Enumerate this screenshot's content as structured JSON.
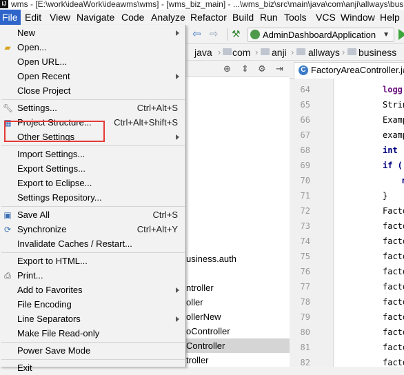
{
  "window": {
    "title": "wms - [E:\\work\\ideaWork\\ideawms\\wms] - [wms_biz_main] - ...\\wms_biz\\src\\main\\java\\com\\anji\\allways\\business\\controller\\FactoryAreaController.java"
  },
  "menubar": {
    "items": [
      "File",
      "Edit",
      "View",
      "Navigate",
      "Code",
      "Analyze",
      "Refactor",
      "Build",
      "Run",
      "Tools",
      "VCS",
      "Window",
      "Help"
    ]
  },
  "file_menu": {
    "new": "New",
    "open": "Open...",
    "open_url": "Open URL...",
    "open_recent": "Open Recent",
    "close_project": "Close Project",
    "settings": "Settings...",
    "settings_shortcut": "Ctrl+Alt+S",
    "project_structure": "Project Structure...",
    "project_structure_shortcut": "Ctrl+Alt+Shift+S",
    "other_settings": "Other Settings",
    "import_settings": "Import Settings...",
    "export_settings": "Export Settings...",
    "export_eclipse": "Export to Eclipse...",
    "settings_repository": "Settings Repository...",
    "save_all": "Save All",
    "save_all_shortcut": "Ctrl+S",
    "synchronize": "Synchronize",
    "synchronize_shortcut": "Ctrl+Alt+Y",
    "invalidate_caches": "Invalidate Caches / Restart...",
    "export_html": "Export to HTML...",
    "print": "Print...",
    "add_favorites": "Add to Favorites",
    "file_encoding": "File Encoding",
    "line_separators": "Line Separators",
    "make_read_only": "Make File Read-only",
    "power_save": "Power Save Mode",
    "exit": "Exit"
  },
  "toolbar": {
    "run_config": "AdminDashboardApplication"
  },
  "breadcrumb": [
    "java",
    "com",
    "anji",
    "allways",
    "business"
  ],
  "project_tree": {
    "rows": [
      "usiness.auth",
      "ntroller",
      "oller",
      "ollerNew",
      "oController",
      "Controller",
      "troller"
    ]
  },
  "editor": {
    "tab_label": "FactoryAreaController.java",
    "line_numbers": [
      "64",
      "65",
      "66",
      "67",
      "68",
      "69",
      "70",
      "71",
      "72",
      "73",
      "74",
      "75",
      "76",
      "77",
      "78",
      "79",
      "80",
      "81",
      "82"
    ],
    "code_lines": [
      "logg",
      "Strin",
      "Examp",
      "examp",
      "int ",
      "if (",
      "r",
      "}",
      "Facto",
      "facto",
      "facto",
      "facto",
      "facto",
      "facto",
      "facto",
      "facto",
      "facto",
      "facto",
      "facto"
    ]
  },
  "colors": {
    "menu_active": "#2f65ca",
    "annotation_box": "#e53935",
    "run_green": "#3ca53c"
  }
}
